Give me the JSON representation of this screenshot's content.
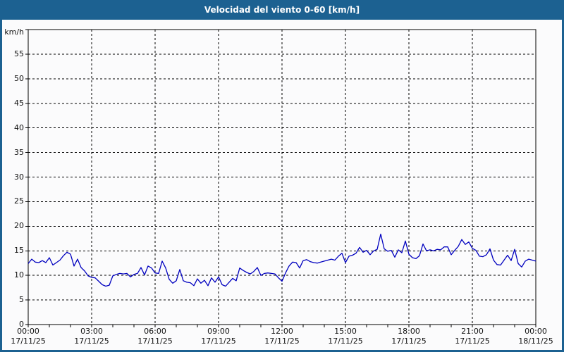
{
  "window": {
    "title": "Velocidad del viento 0-60 [km/h]"
  },
  "colors": {
    "titlebar": "#1c6191",
    "window_background": "#fbfbfc",
    "plot_border": "#000000",
    "grid": "#000000",
    "line": "#0000bf",
    "text": "#111111"
  },
  "chart_data": {
    "type": "line",
    "title": "Velocidad del viento 0-60 [km/h]",
    "ylabel": "km/h",
    "ylim": [
      0,
      60
    ],
    "ytick_step": 5,
    "ytick_labels": [
      "0",
      "5",
      "10",
      "15",
      "20",
      "25",
      "30",
      "35",
      "40",
      "45",
      "50",
      "55"
    ],
    "grid": {
      "style": "dashed",
      "horizontal_every": 5,
      "vertical_every_hours": 3
    },
    "x_axis": {
      "span_hours": 24,
      "minor_tick_every_hours": 1,
      "major_tick_every_hours": 3,
      "major_ticks": [
        {
          "time": "00:00",
          "date": "17/11/25"
        },
        {
          "time": "03:00",
          "date": "17/11/25"
        },
        {
          "time": "06:00",
          "date": "17/11/25"
        },
        {
          "time": "09:00",
          "date": "17/11/25"
        },
        {
          "time": "12:00",
          "date": "17/11/25"
        },
        {
          "time": "15:00",
          "date": "17/11/25"
        },
        {
          "time": "18:00",
          "date": "17/11/25"
        },
        {
          "time": "21:00",
          "date": "17/11/25"
        },
        {
          "time": "00:00",
          "date": "18/11/25"
        }
      ]
    },
    "sample_interval_minutes": 10,
    "series": [
      {
        "name": "wind-speed-km-h",
        "color": "#0000bf",
        "values": [
          12.4,
          13.3,
          12.7,
          12.6,
          13.0,
          12.6,
          13.6,
          12.1,
          12.6,
          13.1,
          14.0,
          14.7,
          14.3,
          11.9,
          13.3,
          11.6,
          10.9,
          9.9,
          9.6,
          9.5,
          8.8,
          8.1,
          7.8,
          8.0,
          9.9,
          10.2,
          10.4,
          10.3,
          10.4,
          9.7,
          10.2,
          10.4,
          11.6,
          10.1,
          11.9,
          11.5,
          10.5,
          10.4,
          12.9,
          11.5,
          9.2,
          8.4,
          8.9,
          11.2,
          8.9,
          8.6,
          8.5,
          7.9,
          9.3,
          8.4,
          9.0,
          7.9,
          9.5,
          8.6,
          9.7,
          8.1,
          7.8,
          8.6,
          9.4,
          8.9,
          11.5,
          11.0,
          10.6,
          10.3,
          10.8,
          11.6,
          10.0,
          10.4,
          10.5,
          10.4,
          10.3,
          9.5,
          8.8,
          10.5,
          11.9,
          12.7,
          12.6,
          11.5,
          13.0,
          13.2,
          12.8,
          12.6,
          12.5,
          12.7,
          12.9,
          13.1,
          13.3,
          13.1,
          13.9,
          14.5,
          12.6,
          13.9,
          14.1,
          14.5,
          15.7,
          14.7,
          15.1,
          14.2,
          15.0,
          15.3,
          18.4,
          15.4,
          14.9,
          15.1,
          13.7,
          15.2,
          14.6,
          17.0,
          14.3,
          13.6,
          13.4,
          14.0,
          16.4,
          15.0,
          15.2,
          15.0,
          15.3,
          15.2,
          15.8,
          15.8,
          14.2,
          15.1,
          15.9,
          17.3,
          16.3,
          16.8,
          15.5,
          15.1,
          13.9,
          13.8,
          14.2,
          15.4,
          13.1,
          12.2,
          12.1,
          13.1,
          14.1,
          13.0,
          15.3,
          12.4,
          11.7,
          12.9,
          13.3,
          13.1,
          12.9
        ]
      }
    ]
  }
}
